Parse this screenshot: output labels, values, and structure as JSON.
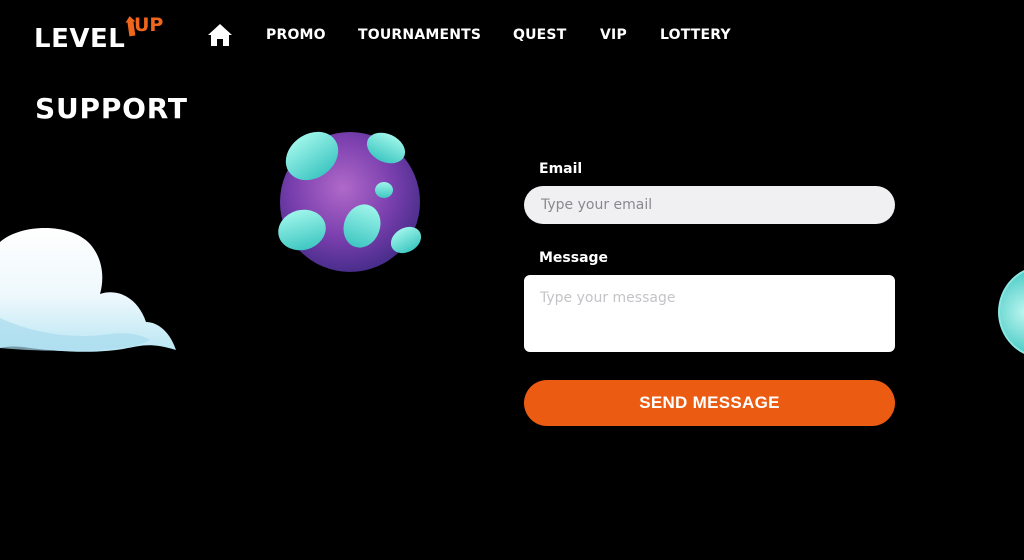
{
  "brand": {
    "logo_main": "LEVEL",
    "logo_accent": "UP",
    "accent_color": "#f0661c"
  },
  "nav": {
    "home_icon": "home-icon",
    "items": [
      {
        "label": "PROMO"
      },
      {
        "label": "TOURNAMENTS"
      },
      {
        "label": "QUEST"
      },
      {
        "label": "VIP"
      },
      {
        "label": "LOTTERY"
      }
    ]
  },
  "page": {
    "title": "SUPPORT"
  },
  "form": {
    "email": {
      "label": "Email",
      "placeholder": "Type your email",
      "value": ""
    },
    "message": {
      "label": "Message",
      "placeholder": "Type your message",
      "value": ""
    },
    "submit_label": "SEND MESSAGE",
    "submit_color": "#ec5b12"
  },
  "decorations": {
    "cloud": "cloud-illustration",
    "planet": "planet-illustration",
    "planet_partial": "planet-illustration-partial"
  }
}
